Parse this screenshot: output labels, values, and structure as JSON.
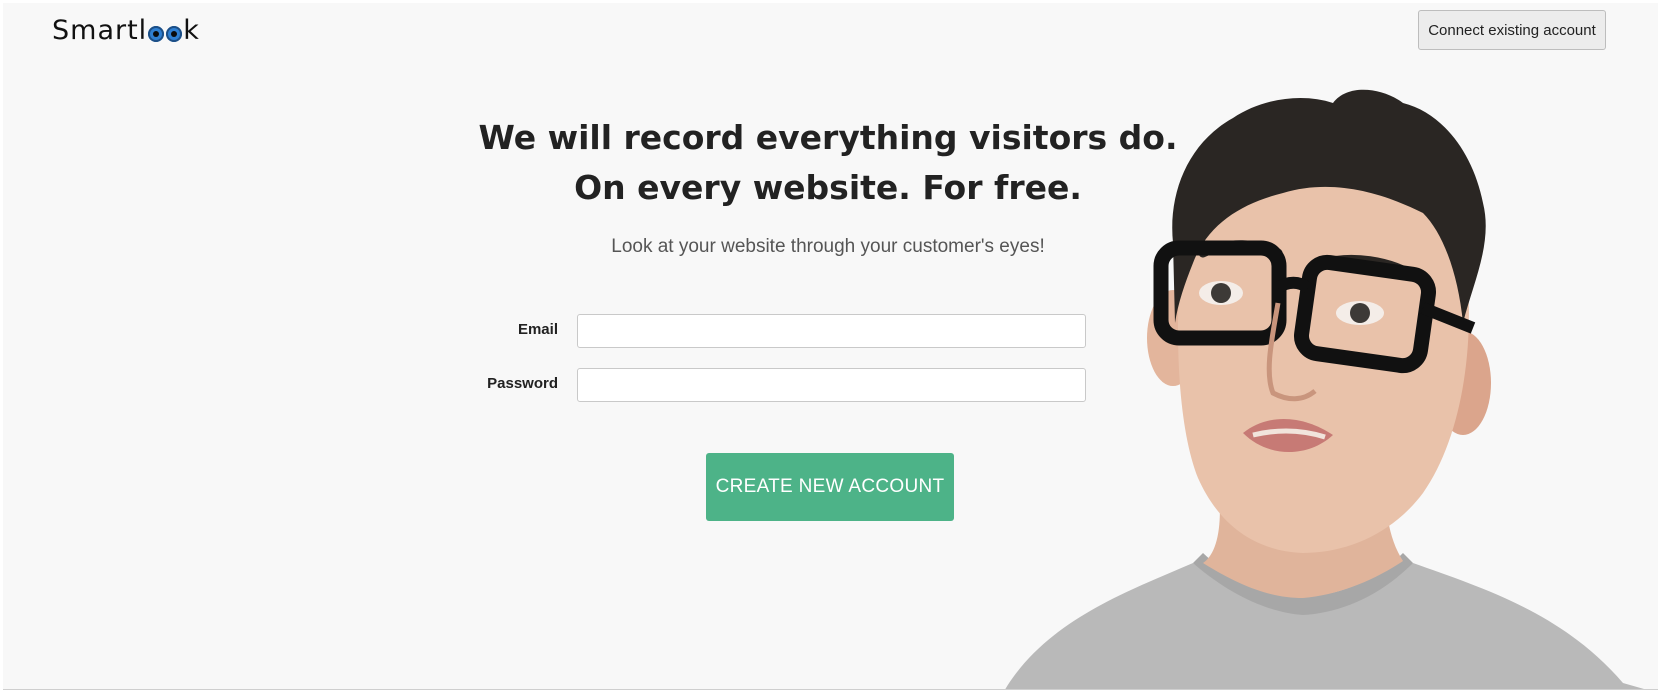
{
  "header": {
    "logo_parts": [
      "Smartl",
      "k"
    ],
    "connect_label": "Connect existing account"
  },
  "hero": {
    "line1": "We will record everything visitors do.",
    "line2": "On every website. For free.",
    "subtitle": "Look at your website through your customer's eyes!"
  },
  "form": {
    "email_label": "Email",
    "email_value": "",
    "password_label": "Password",
    "password_value": "",
    "submit_label": "CREATE NEW ACCOUNT"
  },
  "colors": {
    "background": "#f8f8f8",
    "primary_button": "#4db388",
    "logo_eye": "#2f7fd1"
  }
}
